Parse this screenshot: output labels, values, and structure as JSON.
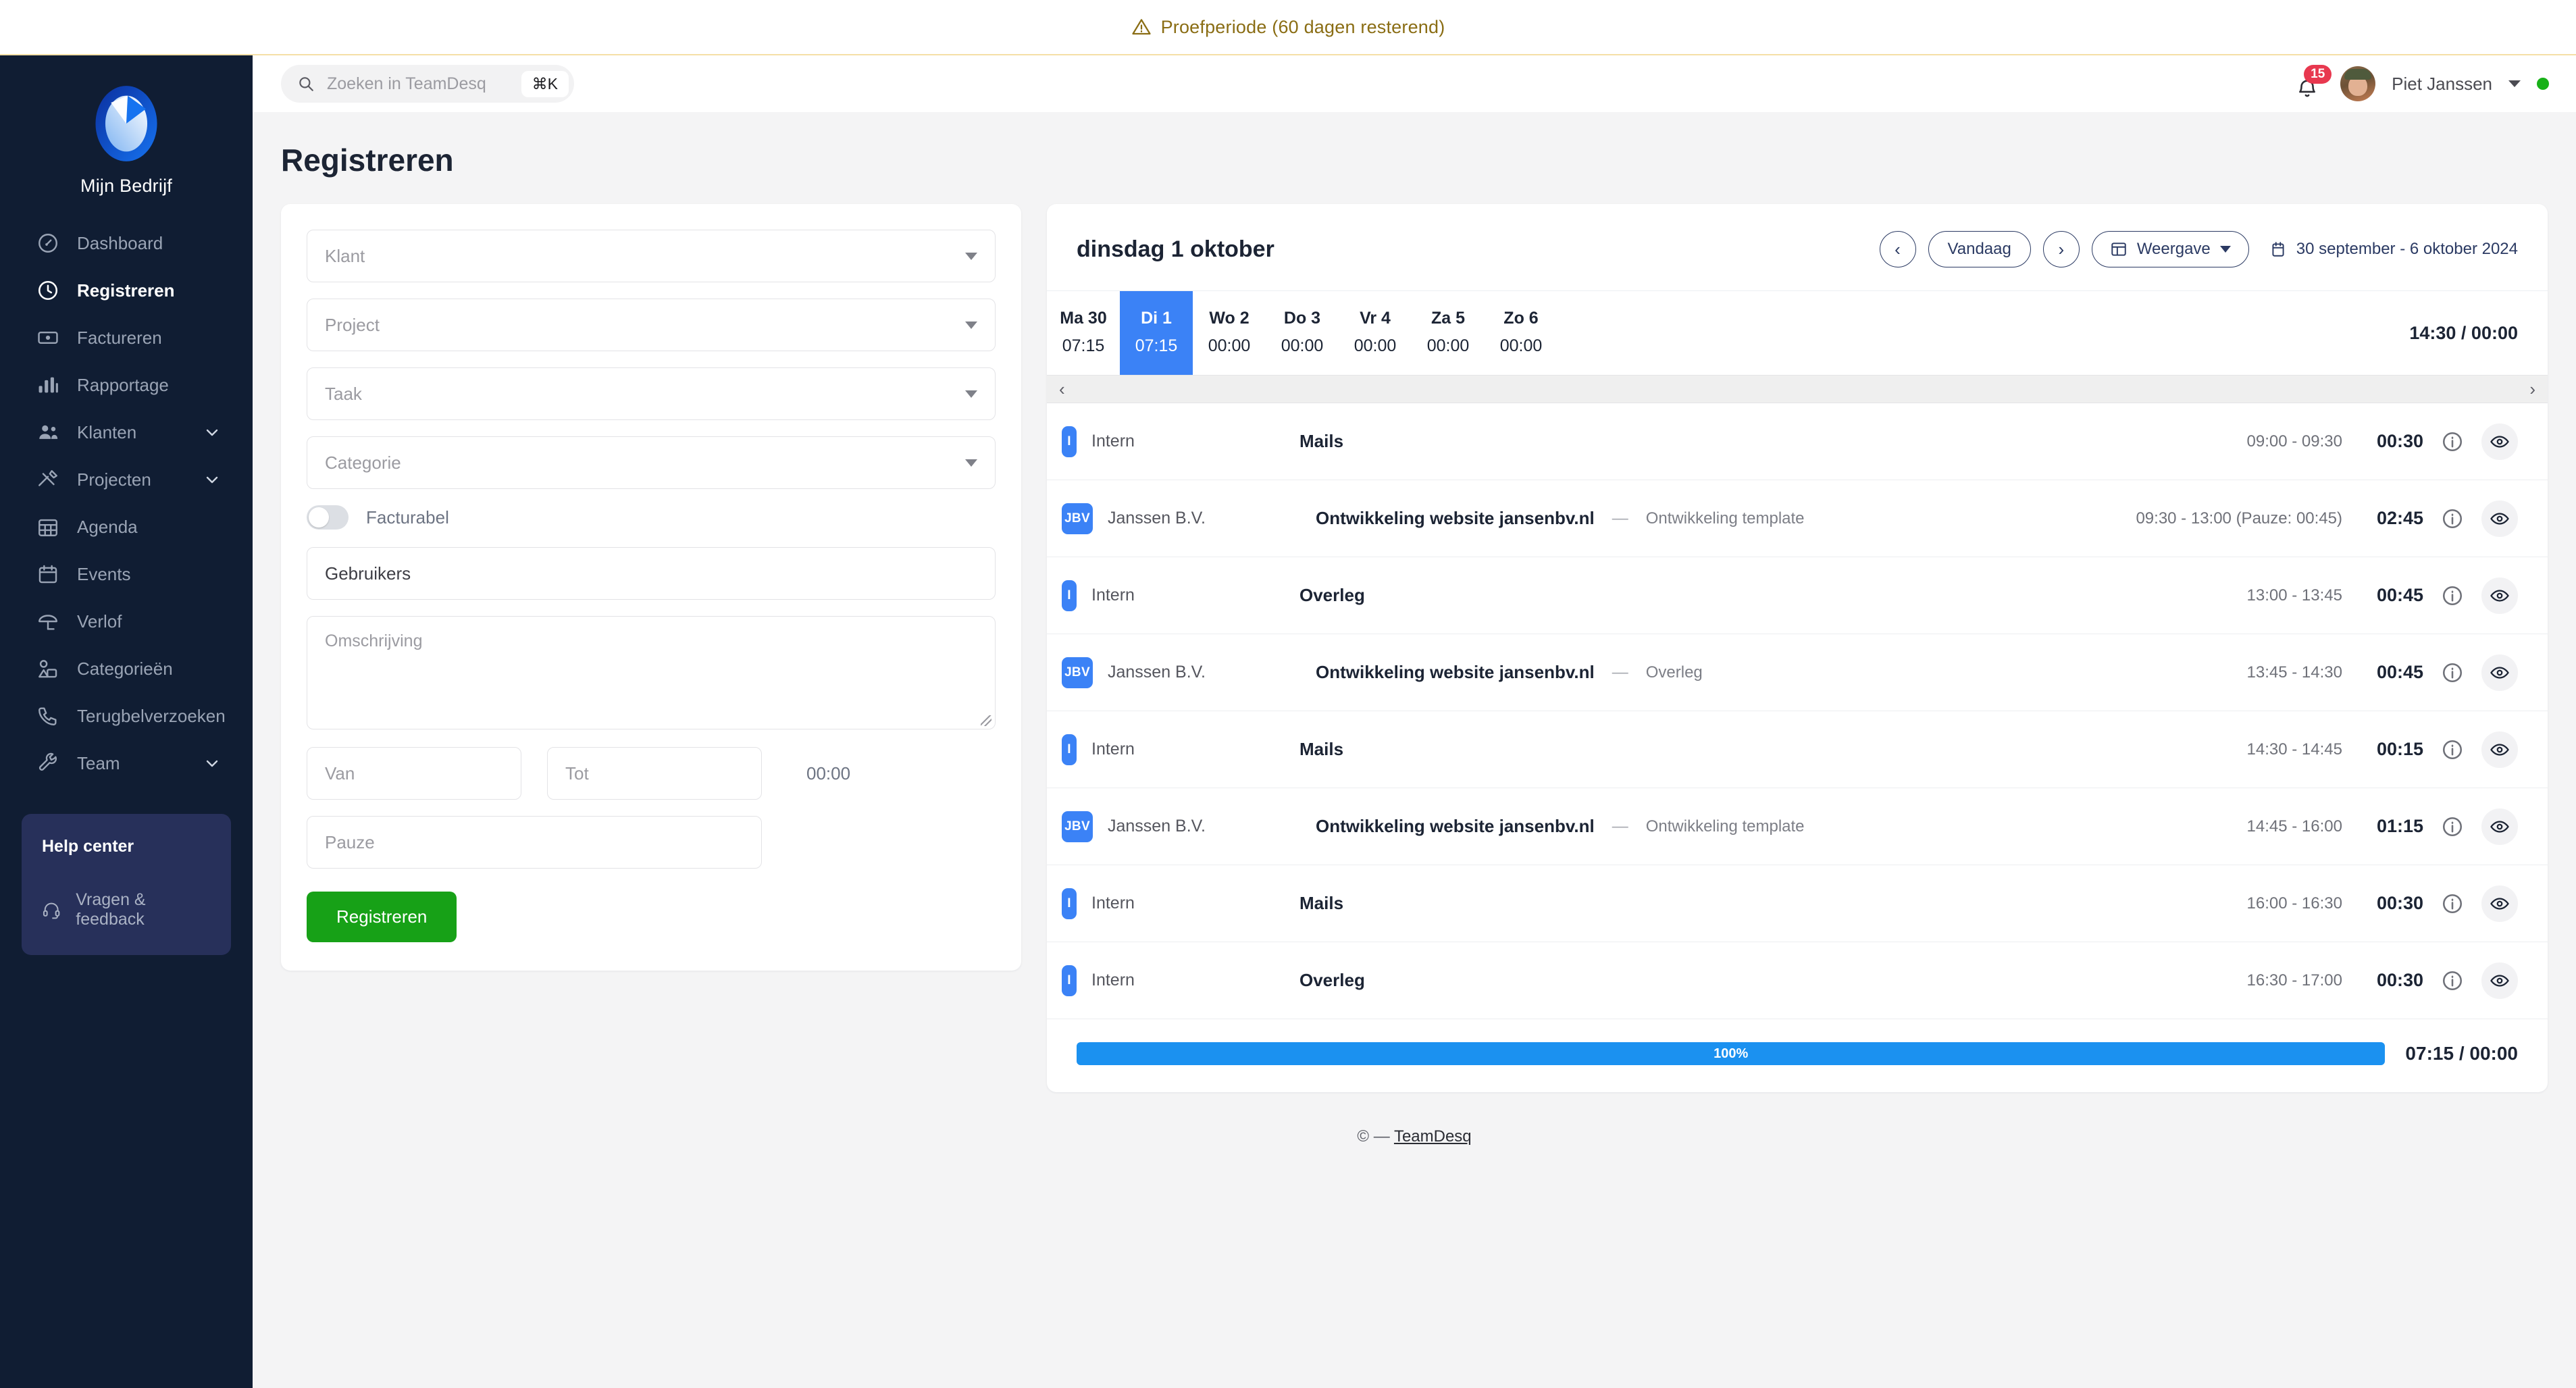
{
  "banner": {
    "icon": "warning-triangle-icon",
    "text": "Proefperiode (60 dagen resterend)"
  },
  "sidebar": {
    "brand_name": "Mijn Bedrijf",
    "items": [
      {
        "label": "Dashboard",
        "icon": "speedometer-icon",
        "active": false,
        "expandable": false
      },
      {
        "label": "Registreren",
        "icon": "clock-icon",
        "active": true,
        "expandable": false
      },
      {
        "label": "Factureren",
        "icon": "banknote-icon",
        "active": false,
        "expandable": false
      },
      {
        "label": "Rapportage",
        "icon": "bar-chart-icon",
        "active": false,
        "expandable": false
      },
      {
        "label": "Klanten",
        "icon": "users-icon",
        "active": false,
        "expandable": true
      },
      {
        "label": "Projecten",
        "icon": "tools-icon",
        "active": false,
        "expandable": true
      },
      {
        "label": "Agenda",
        "icon": "calendar-grid-icon",
        "active": false,
        "expandable": false
      },
      {
        "label": "Events",
        "icon": "calendar-icon",
        "active": false,
        "expandable": false
      },
      {
        "label": "Verlof",
        "icon": "beach-umbrella-icon",
        "active": false,
        "expandable": false
      },
      {
        "label": "Categorieën",
        "icon": "shapes-icon",
        "active": false,
        "expandable": false
      },
      {
        "label": "Terugbelverzoeken",
        "icon": "phone-icon",
        "active": false,
        "expandable": false
      },
      {
        "label": "Team",
        "icon": "wrench-icon",
        "active": false,
        "expandable": true
      }
    ],
    "help": {
      "title": "Help center",
      "link_label": "Vragen & feedback",
      "link_icon": "headset-icon"
    }
  },
  "topbar": {
    "search_placeholder": "Zoeken in TeamDesq",
    "search_icon": "search-icon",
    "shortcut": "⌘K",
    "notifications_count": "15",
    "user_name": "Piet Janssen"
  },
  "page": {
    "title": "Registreren"
  },
  "form": {
    "klant_placeholder": "Klant",
    "project_placeholder": "Project",
    "taak_placeholder": "Taak",
    "categorie_placeholder": "Categorie",
    "facturabel_label": "Facturabel",
    "facturabel_on": false,
    "gebruikers_value": "Gebruikers",
    "omschrijving_placeholder": "Omschrijving",
    "van_placeholder": "Van",
    "tot_placeholder": "Tot",
    "duration_value": "00:00",
    "pauze_placeholder": "Pauze",
    "submit_label": "Registreren"
  },
  "entries_panel": {
    "date_heading": "dinsdag 1 oktober",
    "prev_label": "‹",
    "today_label": "Vandaag",
    "next_label": "›",
    "view_label": "Weergave",
    "view_icon": "layout-icon",
    "range_icon": "calendar-icon",
    "range_label": "30 september - 6 oktober 2024",
    "week_total": "14:30 / 00:00",
    "scroll_left": "‹",
    "scroll_right": "›",
    "days": [
      {
        "name": "Ma 30",
        "value": "07:15",
        "selected": false
      },
      {
        "name": "Di 1",
        "value": "07:15",
        "selected": true
      },
      {
        "name": "Wo 2",
        "value": "00:00",
        "selected": false
      },
      {
        "name": "Do 3",
        "value": "00:00",
        "selected": false
      },
      {
        "name": "Vr 4",
        "value": "00:00",
        "selected": false
      },
      {
        "name": "Za 5",
        "value": "00:00",
        "selected": false
      },
      {
        "name": "Zo 6",
        "value": "00:00",
        "selected": false
      }
    ],
    "rows": [
      {
        "chip": "I",
        "chip_narrow": true,
        "client": "Intern",
        "project": "Mails",
        "task": "",
        "time": "09:00 - 09:30",
        "duration": "00:30"
      },
      {
        "chip": "JBV",
        "chip_narrow": false,
        "client": "Janssen B.V.",
        "project": "Ontwikkeling website jansenbv.nl",
        "task": "Ontwikkeling template",
        "time": "09:30 - 13:00 (Pauze: 00:45)",
        "duration": "02:45"
      },
      {
        "chip": "I",
        "chip_narrow": true,
        "client": "Intern",
        "project": "Overleg",
        "task": "",
        "time": "13:00 - 13:45",
        "duration": "00:45"
      },
      {
        "chip": "JBV",
        "chip_narrow": false,
        "client": "Janssen B.V.",
        "project": "Ontwikkeling website jansenbv.nl",
        "task": "Overleg",
        "time": "13:45 - 14:30",
        "duration": "00:45"
      },
      {
        "chip": "I",
        "chip_narrow": true,
        "client": "Intern",
        "project": "Mails",
        "task": "",
        "time": "14:30 - 14:45",
        "duration": "00:15"
      },
      {
        "chip": "JBV",
        "chip_narrow": false,
        "client": "Janssen B.V.",
        "project": "Ontwikkeling website jansenbv.nl",
        "task": "Ontwikkeling template",
        "time": "14:45 - 16:00",
        "duration": "01:15"
      },
      {
        "chip": "I",
        "chip_narrow": true,
        "client": "Intern",
        "project": "Mails",
        "task": "",
        "time": "16:00 - 16:30",
        "duration": "00:30"
      },
      {
        "chip": "I",
        "chip_narrow": true,
        "client": "Intern",
        "project": "Overleg",
        "task": "",
        "time": "16:30 - 17:00",
        "duration": "00:30"
      }
    ],
    "progress": {
      "percent_label": "100%",
      "percent": 100,
      "total": "07:15 / 00:00"
    }
  },
  "footer": {
    "copyright": "© —",
    "link": "TeamDesq"
  },
  "colors": {
    "sidebar_bg": "#101d33",
    "help_card_bg": "#27305a",
    "accent_blue": "#3b82f6",
    "progress_blue": "#1b91f0",
    "submit_green": "#17a117",
    "badge_red": "#e8384f",
    "banner_text": "#8a6d14",
    "online_green": "#18b118"
  }
}
